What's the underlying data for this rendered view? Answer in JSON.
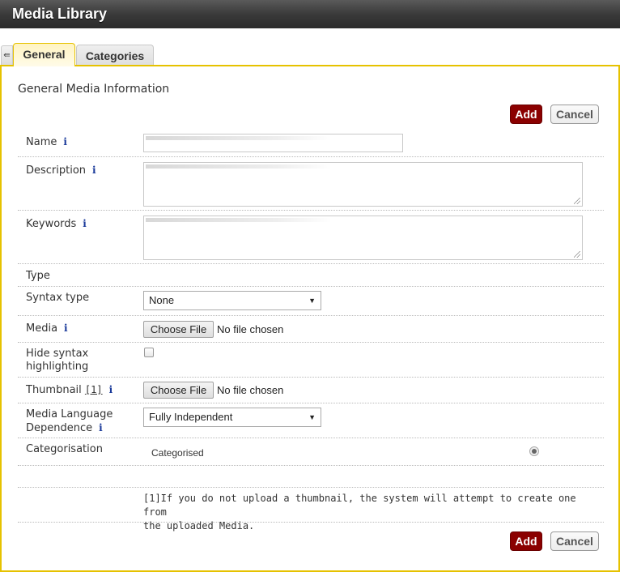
{
  "window": {
    "title": "Media Library"
  },
  "tabs": {
    "back_icon": "⇚",
    "items": [
      {
        "label": "General",
        "active": true
      },
      {
        "label": "Categories",
        "active": false
      }
    ]
  },
  "form": {
    "section_title": "General Media Information",
    "buttons": {
      "add": "Add",
      "cancel": "Cancel"
    },
    "info_glyph": "i",
    "fields": {
      "name": {
        "label": "Name",
        "value": ""
      },
      "description": {
        "label": "Description",
        "value": ""
      },
      "keywords": {
        "label": "Keywords",
        "value": ""
      },
      "type": {
        "label": "Type"
      },
      "syntax_type": {
        "label": "Syntax type",
        "selected": "None"
      },
      "media": {
        "label": "Media",
        "button": "Choose File",
        "status": "No file chosen"
      },
      "hide_syntax": {
        "label_line1": "Hide syntax",
        "label_line2": "highlighting",
        "checked": false
      },
      "thumbnail": {
        "label": "Thumbnail",
        "footnote_ref": "[1]",
        "button": "Choose File",
        "status": "No file chosen"
      },
      "language_dependence": {
        "label_line1": "Media Language",
        "label_line2": "Dependence",
        "selected": "Fully Independent"
      },
      "categorisation": {
        "label": "Categorisation",
        "option": "Categorised",
        "selected": true
      }
    },
    "footnote_line1": "[1]If you do not upload a thumbnail, the system will attempt to create one from",
    "footnote_line2": "the uploaded Media."
  }
}
